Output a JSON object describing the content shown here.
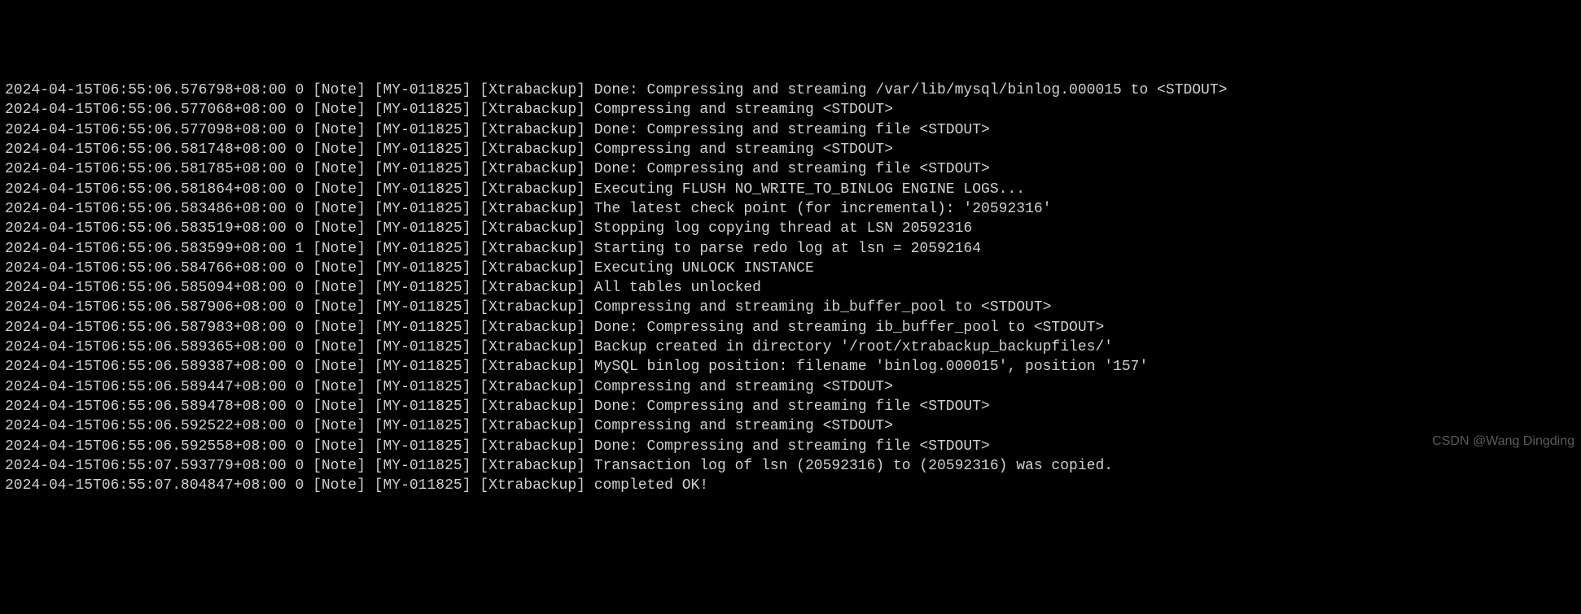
{
  "watermark": "CSDN @Wang Dingding",
  "log_lines": [
    {
      "ts": "2024-04-15T06:55:06.576798+08:00",
      "tid": "0",
      "level": "[Note]",
      "code": "[MY-011825]",
      "component": "[Xtrabackup]",
      "msg": "Done: Compressing and streaming /var/lib/mysql/binlog.000015 to <STDOUT>"
    },
    {
      "ts": "2024-04-15T06:55:06.577068+08:00",
      "tid": "0",
      "level": "[Note]",
      "code": "[MY-011825]",
      "component": "[Xtrabackup]",
      "msg": "Compressing and streaming <STDOUT>"
    },
    {
      "ts": "2024-04-15T06:55:06.577098+08:00",
      "tid": "0",
      "level": "[Note]",
      "code": "[MY-011825]",
      "component": "[Xtrabackup]",
      "msg": "Done: Compressing and streaming file <STDOUT>"
    },
    {
      "ts": "2024-04-15T06:55:06.581748+08:00",
      "tid": "0",
      "level": "[Note]",
      "code": "[MY-011825]",
      "component": "[Xtrabackup]",
      "msg": "Compressing and streaming <STDOUT>"
    },
    {
      "ts": "2024-04-15T06:55:06.581785+08:00",
      "tid": "0",
      "level": "[Note]",
      "code": "[MY-011825]",
      "component": "[Xtrabackup]",
      "msg": "Done: Compressing and streaming file <STDOUT>"
    },
    {
      "ts": "2024-04-15T06:55:06.581864+08:00",
      "tid": "0",
      "level": "[Note]",
      "code": "[MY-011825]",
      "component": "[Xtrabackup]",
      "msg": "Executing FLUSH NO_WRITE_TO_BINLOG ENGINE LOGS..."
    },
    {
      "ts": "2024-04-15T06:55:06.583486+08:00",
      "tid": "0",
      "level": "[Note]",
      "code": "[MY-011825]",
      "component": "[Xtrabackup]",
      "msg": "The latest check point (for incremental): '20592316'"
    },
    {
      "ts": "2024-04-15T06:55:06.583519+08:00",
      "tid": "0",
      "level": "[Note]",
      "code": "[MY-011825]",
      "component": "[Xtrabackup]",
      "msg": "Stopping log copying thread at LSN 20592316"
    },
    {
      "ts": "2024-04-15T06:55:06.583599+08:00",
      "tid": "1",
      "level": "[Note]",
      "code": "[MY-011825]",
      "component": "[Xtrabackup]",
      "msg": "Starting to parse redo log at lsn = 20592164"
    },
    {
      "ts": "2024-04-15T06:55:06.584766+08:00",
      "tid": "0",
      "level": "[Note]",
      "code": "[MY-011825]",
      "component": "[Xtrabackup]",
      "msg": "Executing UNLOCK INSTANCE"
    },
    {
      "ts": "2024-04-15T06:55:06.585094+08:00",
      "tid": "0",
      "level": "[Note]",
      "code": "[MY-011825]",
      "component": "[Xtrabackup]",
      "msg": "All tables unlocked"
    },
    {
      "ts": "2024-04-15T06:55:06.587906+08:00",
      "tid": "0",
      "level": "[Note]",
      "code": "[MY-011825]",
      "component": "[Xtrabackup]",
      "msg": "Compressing and streaming ib_buffer_pool to <STDOUT>"
    },
    {
      "ts": "2024-04-15T06:55:06.587983+08:00",
      "tid": "0",
      "level": "[Note]",
      "code": "[MY-011825]",
      "component": "[Xtrabackup]",
      "msg": "Done: Compressing and streaming ib_buffer_pool to <STDOUT>"
    },
    {
      "ts": "2024-04-15T06:55:06.589365+08:00",
      "tid": "0",
      "level": "[Note]",
      "code": "[MY-011825]",
      "component": "[Xtrabackup]",
      "msg": "Backup created in directory '/root/xtrabackup_backupfiles/'"
    },
    {
      "ts": "2024-04-15T06:55:06.589387+08:00",
      "tid": "0",
      "level": "[Note]",
      "code": "[MY-011825]",
      "component": "[Xtrabackup]",
      "msg": "MySQL binlog position: filename 'binlog.000015', position '157'"
    },
    {
      "ts": "2024-04-15T06:55:06.589447+08:00",
      "tid": "0",
      "level": "[Note]",
      "code": "[MY-011825]",
      "component": "[Xtrabackup]",
      "msg": "Compressing and streaming <STDOUT>"
    },
    {
      "ts": "2024-04-15T06:55:06.589478+08:00",
      "tid": "0",
      "level": "[Note]",
      "code": "[MY-011825]",
      "component": "[Xtrabackup]",
      "msg": "Done: Compressing and streaming file <STDOUT>"
    },
    {
      "ts": "2024-04-15T06:55:06.592522+08:00",
      "tid": "0",
      "level": "[Note]",
      "code": "[MY-011825]",
      "component": "[Xtrabackup]",
      "msg": "Compressing and streaming <STDOUT>"
    },
    {
      "ts": "2024-04-15T06:55:06.592558+08:00",
      "tid": "0",
      "level": "[Note]",
      "code": "[MY-011825]",
      "component": "[Xtrabackup]",
      "msg": "Done: Compressing and streaming file <STDOUT>"
    },
    {
      "ts": "2024-04-15T06:55:07.593779+08:00",
      "tid": "0",
      "level": "[Note]",
      "code": "[MY-011825]",
      "component": "[Xtrabackup]",
      "msg": "Transaction log of lsn (20592316) to (20592316) was copied."
    },
    {
      "ts": "2024-04-15T06:55:07.804847+08:00",
      "tid": "0",
      "level": "[Note]",
      "code": "[MY-011825]",
      "component": "[Xtrabackup]",
      "msg": "completed OK!"
    }
  ]
}
